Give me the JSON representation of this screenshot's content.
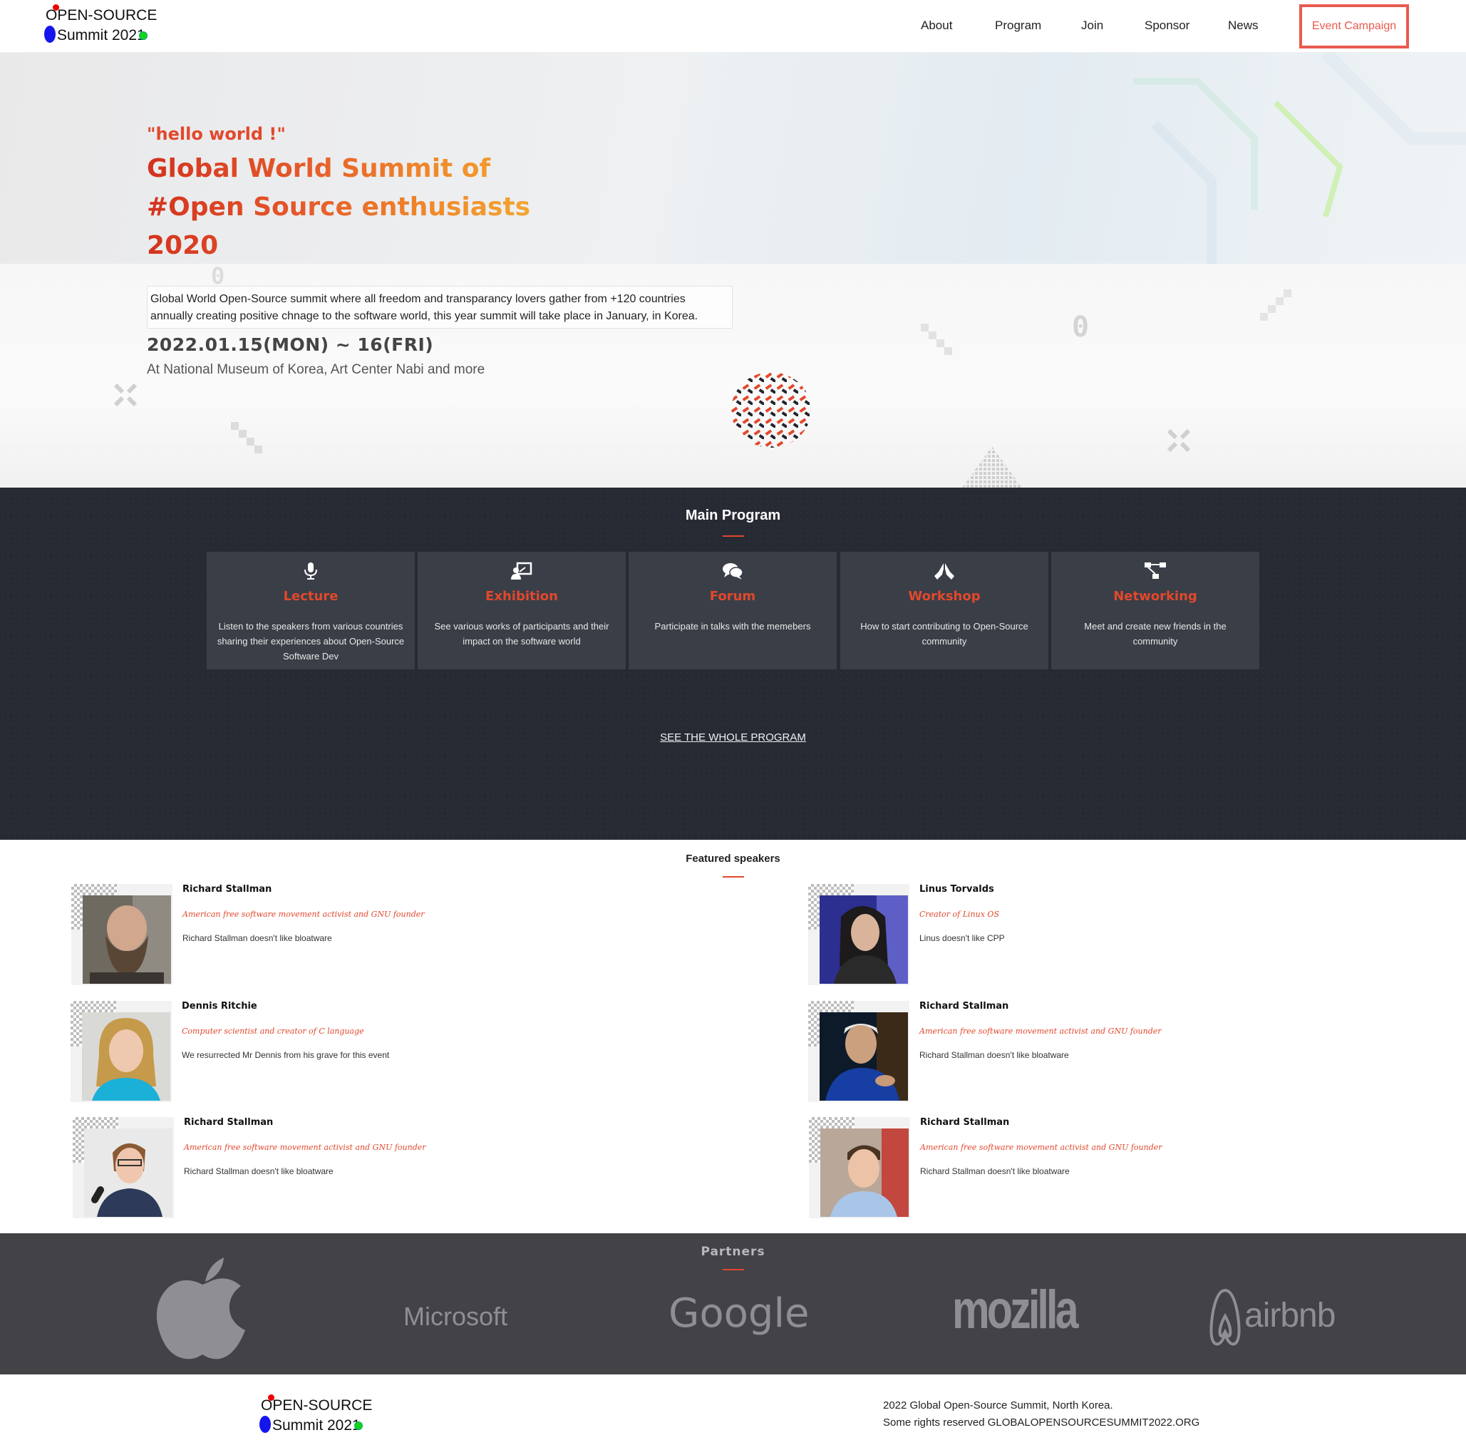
{
  "brand": {
    "line1": "OPEN-SOURCE",
    "line2": "Summit 2021"
  },
  "nav": {
    "links": [
      "About",
      "Program",
      "Join",
      "Sponsor",
      "News"
    ],
    "cta": "Event Campaign"
  },
  "hero": {
    "subtitle": "\"hello world !\"",
    "title_lines": [
      "Global World Summit of",
      "#Open Source enthusiasts",
      "2020"
    ],
    "description": "Global World Open-Source summit where all freedom and transparancy lovers gather from +120 countries annually creating positive chnage to the software world, this year summit will take place in January, in Korea.",
    "date": "2022.01.15(MON) ~ 16(FRI)",
    "venue": "At National Museum of Korea, Art Center Nabi and more",
    "deco_zero": "0"
  },
  "program": {
    "title": "Main Program",
    "cards": [
      {
        "icon": "microphone-icon",
        "title": "Lecture",
        "desc": "Listen to the speakers from various countries sharing their experiences about Open-Source Software Dev"
      },
      {
        "icon": "presentation-icon",
        "title": "Exhibition",
        "desc": "See various works of participants and their impact on the software world"
      },
      {
        "icon": "chat-icon",
        "title": "Forum",
        "desc": "Participate in talks with the memebers"
      },
      {
        "icon": "hands-icon",
        "title": "Workshop",
        "desc": "How to start contributing to Open-Source community"
      },
      {
        "icon": "network-icon",
        "title": "Networking",
        "desc": "Meet and create new friends in the community"
      }
    ],
    "see_all": "SEE THE WHOLE PROGRAM"
  },
  "speakers": {
    "title": "Featured speakers",
    "items": [
      {
        "name": "Richard Stallman",
        "role": "American free software movement activist and GNU founder",
        "bio": "Richard Stallman doesn't like bloatware"
      },
      {
        "name": "Linus Torvalds",
        "role": "Creator of Linux OS",
        "bio": "Linus doesn't like CPP"
      },
      {
        "name": "Dennis Ritchie",
        "role": "Computer scientist and creator of C language",
        "bio": "We resurrected Mr Dennis from his grave for this event"
      },
      {
        "name": "Richard Stallman",
        "role": "American free software movement activist and GNU founder",
        "bio": "Richard Stallman doesn't like bloatware"
      },
      {
        "name": "Richard Stallman",
        "role": "American free software movement activist and GNU founder",
        "bio": "Richard Stallman doesn't like bloatware"
      },
      {
        "name": "Richard Stallman",
        "role": "American free software movement activist and GNU founder",
        "bio": "Richard Stallman doesn't like bloatware"
      }
    ]
  },
  "partners": {
    "title": "Partners",
    "logos": [
      "apple-logo",
      "Microsoft",
      "Google",
      "mozilla",
      "airbnb"
    ]
  },
  "footer": {
    "line1": "2022 Global Open-Source Summit, North Korea.",
    "line2": "Some rights reserved GLOBALOPENSOURCESUMMIT2022.ORG"
  },
  "colors": {
    "accent": "#e2482c",
    "dark_section": "#262a33",
    "card": "#3a3e47",
    "partners_bg": "#424247"
  }
}
